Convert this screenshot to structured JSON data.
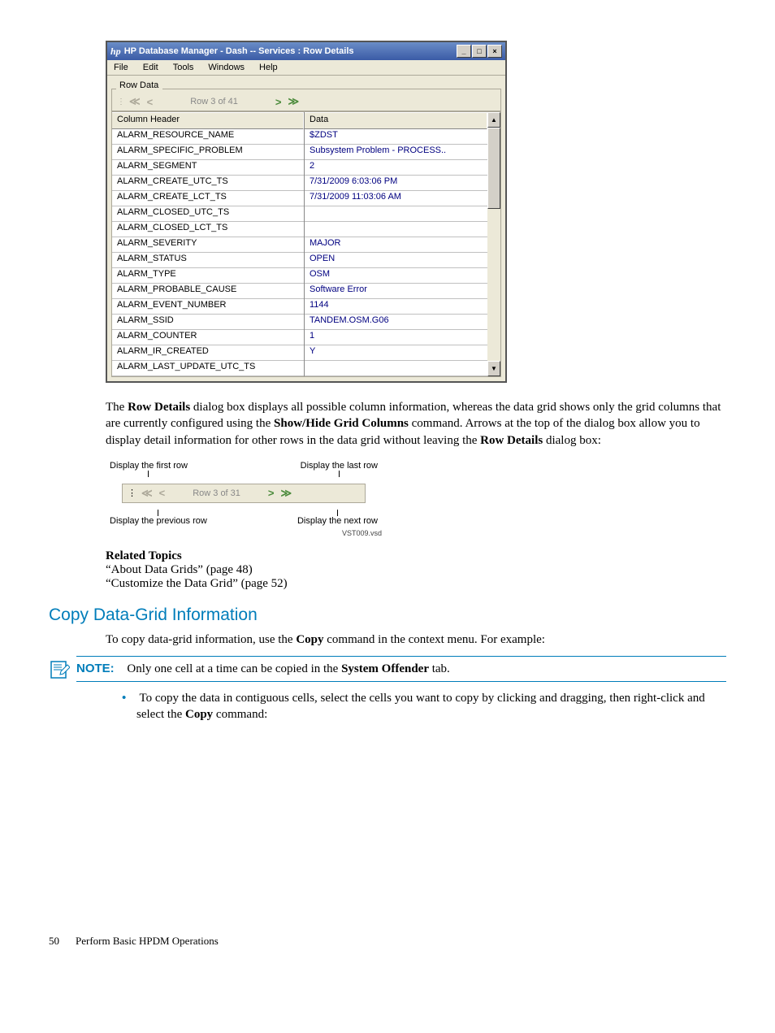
{
  "window": {
    "title": "HP Database Manager - Dash -- Services : Row Details",
    "hp_logo": "hp",
    "menus": [
      "File",
      "Edit",
      "Tools",
      "Windows",
      "Help"
    ],
    "fieldset_label": "Row Data",
    "row_counter": "Row 3 of 41",
    "columns": {
      "left": "Column Header",
      "right": "Data"
    },
    "rows": [
      {
        "h": "ALARM_RESOURCE_NAME",
        "d": "$ZDST"
      },
      {
        "h": "ALARM_SPECIFIC_PROBLEM",
        "d": "Subsystem Problem - PROCESS.."
      },
      {
        "h": "ALARM_SEGMENT",
        "d": "2"
      },
      {
        "h": "ALARM_CREATE_UTC_TS",
        "d": "7/31/2009 6:03:06 PM"
      },
      {
        "h": "ALARM_CREATE_LCT_TS",
        "d": "7/31/2009 11:03:06 AM"
      },
      {
        "h": "ALARM_CLOSED_UTC_TS",
        "d": ""
      },
      {
        "h": "ALARM_CLOSED_LCT_TS",
        "d": ""
      },
      {
        "h": "ALARM_SEVERITY",
        "d": "MAJOR"
      },
      {
        "h": "ALARM_STATUS",
        "d": "OPEN"
      },
      {
        "h": "ALARM_TYPE",
        "d": "OSM"
      },
      {
        "h": "ALARM_PROBABLE_CAUSE",
        "d": "Software Error"
      },
      {
        "h": "ALARM_EVENT_NUMBER",
        "d": "1144"
      },
      {
        "h": "ALARM_SSID",
        "d": "TANDEM.OSM.G06"
      },
      {
        "h": "ALARM_COUNTER",
        "d": "1"
      },
      {
        "h": "ALARM_IR_CREATED",
        "d": "Y"
      },
      {
        "h": "ALARM_LAST_UPDATE_UTC_TS",
        "d": ""
      }
    ]
  },
  "paragraph1": {
    "t1": "The ",
    "b1": "Row Details",
    "t2": " dialog box displays all possible column information, whereas the data grid shows only the grid columns that are currently configured using the ",
    "b2": "Show/Hide Grid Columns",
    "t3": " command. Arrows at the top of the dialog box allow you to display detail information for other rows in the data grid without leaving the ",
    "b3": "Row Details",
    "t4": " dialog box:"
  },
  "diagram": {
    "first": "Display the first row",
    "last": "Display the last row",
    "prev": "Display the previous row",
    "next": "Display the next row",
    "counter": "Row 3 of 31",
    "vsd": "VST009.vsd"
  },
  "related": {
    "heading": "Related Topics",
    "link1": "“About Data Grids” (page 48)",
    "link2": "“Customize the Data Grid” (page 52)"
  },
  "section_heading": "Copy Data-Grid Information",
  "paragraph2": {
    "t1": "To copy data-grid information, use the ",
    "b1": "Copy",
    "t2": " command in the context menu. For example:"
  },
  "note": {
    "label": "NOTE:",
    "t1": "Only one cell at a time can be copied in the ",
    "b1": "System Offender",
    "t2": " tab."
  },
  "bullet": {
    "t1": "To copy the data in contiguous cells, select the cells you want to copy by clicking and dragging, then right-click and select the ",
    "b1": "Copy",
    "t2": " command:"
  },
  "footer": {
    "page": "50",
    "chapter": "Perform Basic HPDM Operations"
  }
}
